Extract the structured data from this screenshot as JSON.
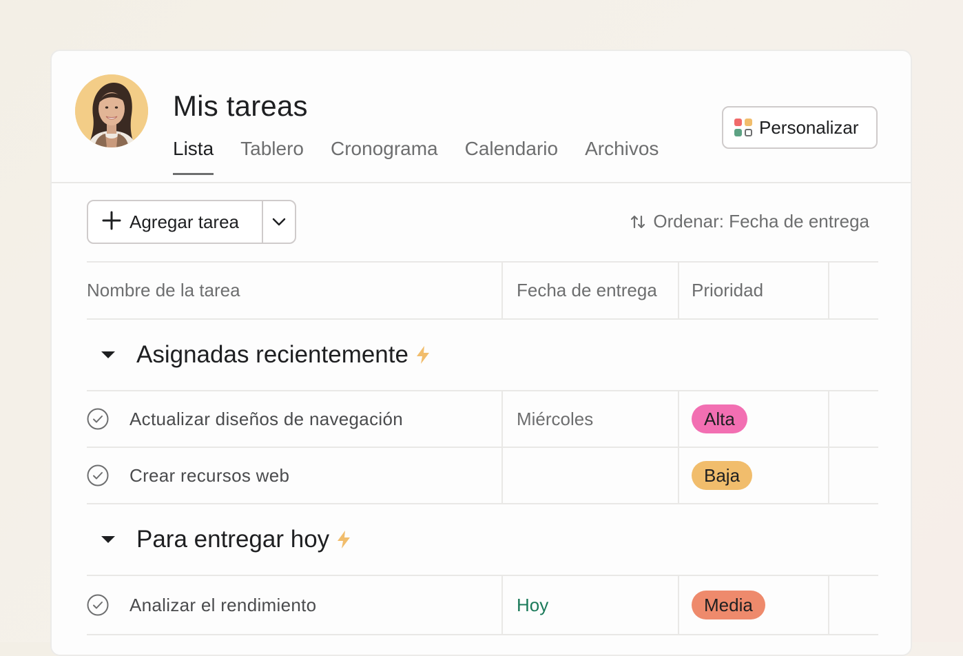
{
  "header": {
    "title": "Mis tareas",
    "tabs": [
      {
        "label": "Lista",
        "active": true
      },
      {
        "label": "Tablero",
        "active": false
      },
      {
        "label": "Cronograma",
        "active": false
      },
      {
        "label": "Calendario",
        "active": false
      },
      {
        "label": "Archivos",
        "active": false
      }
    ],
    "customize_label": "Personalizar",
    "customize_icon_colors": [
      "#f06a6a",
      "#f1bd6c",
      "#5da283",
      "#ffffff"
    ]
  },
  "toolbar": {
    "add_task_label": "Agregar tarea",
    "sort_label": "Ordenar: Fecha de entrega"
  },
  "table": {
    "columns": [
      "Nombre de la tarea",
      "Fecha de entrega",
      "Prioridad"
    ],
    "sections": [
      {
        "title": "Asignadas recientemente",
        "tasks": [
          {
            "name": "Actualizar diseños de navegación",
            "due": "Miércoles",
            "priority": "Alta",
            "priority_color": "#f26fb2"
          },
          {
            "name": "Crear recursos web",
            "due": "",
            "priority": "Baja",
            "priority_color": "#f1bd6c"
          }
        ]
      },
      {
        "title": "Para entregar hoy",
        "tasks": [
          {
            "name": "Analizar el rendimiento",
            "due": "Hoy",
            "priority": "Media",
            "priority_color": "#ee8a6c"
          }
        ]
      }
    ]
  },
  "colors": {
    "bolt": "#f1bd6c",
    "today": "#1b7a5a"
  }
}
